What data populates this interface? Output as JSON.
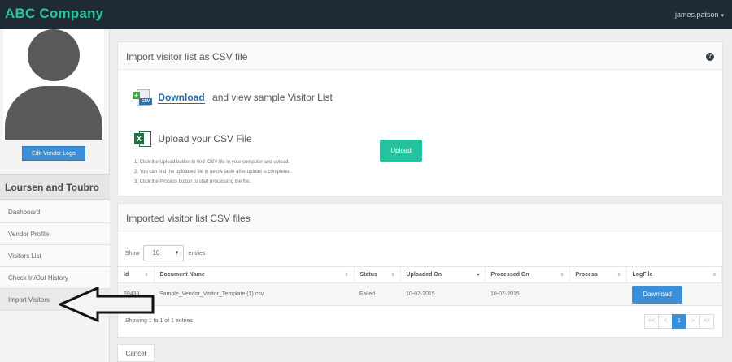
{
  "header": {
    "brand": "ABC Company",
    "user": "james.patson",
    "user_caret": "▾"
  },
  "sidebar": {
    "edit_logo_label": "Edit Vendor Logo",
    "company_name": "Loursen and Toubro",
    "items": [
      {
        "label": "Dashboard"
      },
      {
        "label": "Vendor Profile"
      },
      {
        "label": "Visitors List"
      },
      {
        "label": "Check In/Out History"
      },
      {
        "label": "Import Visitors"
      }
    ]
  },
  "import_panel": {
    "title": "Import visitor list as CSV file",
    "help": "?",
    "csv_tag": "CSV",
    "download_link": "Download",
    "download_rest": "and view sample Visitor List",
    "upload_heading": "Upload your CSV File",
    "steps": [
      "1.  Click the Upload button to find .CSV file in your computer and upload.",
      "2.  You can find the uploaded file in below table after upload is completed.",
      "3.  Click the Process button to start processing the file."
    ],
    "upload_button": "Upload"
  },
  "files_panel": {
    "title": "Imported visitor list CSV files",
    "show_label": "Show",
    "entries_value": "10",
    "entries_label": "entries",
    "columns": [
      "Id",
      "Document Name",
      "Status",
      "Uploaded On",
      "Processed On",
      "Process",
      "LogFile"
    ],
    "rows": [
      {
        "id": "69438",
        "document": "Sample_Vendor_Visitor_Template (1).csv",
        "status": "Failed",
        "uploaded": "10-07-2015",
        "processed": "10-07-2015",
        "process": "",
        "logfile_button": "Download"
      }
    ],
    "showing": "Showing 1 to 1 of 1 entries",
    "pager": [
      "<<",
      "<",
      "1",
      ">",
      ">>"
    ],
    "current_page": "1"
  },
  "cancel_button": "Cancel",
  "colors": {
    "topbar": "#1e2b37",
    "brand": "#2bc4a3",
    "primary": "#3b8fd9",
    "upload": "#26c29d"
  }
}
